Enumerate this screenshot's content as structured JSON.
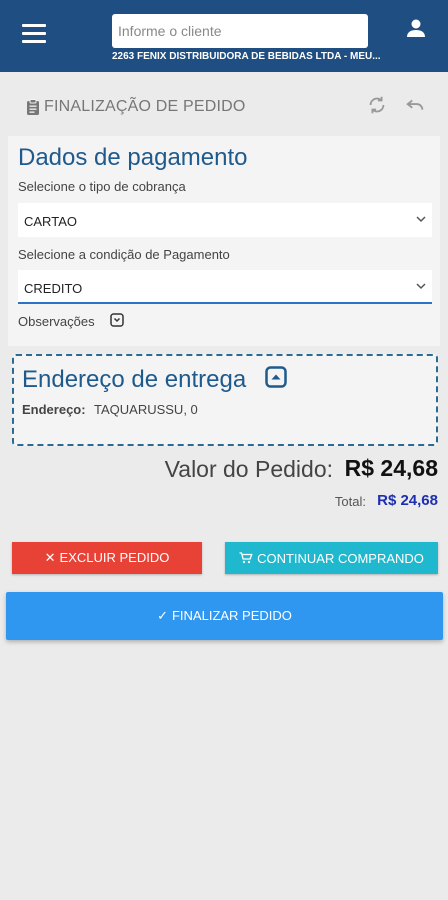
{
  "topbar": {
    "client_placeholder": "Informe o cliente",
    "client_name": "2263 FENIX DISTRIBUIDORA DE BEBIDAS LTDA - MEU..."
  },
  "header": {
    "title": "FINALIZAÇÃO DE PEDIDO"
  },
  "payment": {
    "title": "Dados de pagamento",
    "billing_label": "Selecione o tipo de cobrança",
    "billing_value": "CARTAO",
    "condition_label": "Selecione a condição de Pagamento",
    "condition_value": "CREDITO",
    "observations_label": "Observações"
  },
  "address": {
    "title": "Endereço de entrega",
    "label": "Endereço:",
    "value": "TAQUARUSSU, 0"
  },
  "summary": {
    "order_value_label": "Valor do Pedido:",
    "order_value": "R$ 24,68",
    "total_label": "Total:",
    "total_value": "R$ 24,68"
  },
  "actions": {
    "delete_label": "EXCLUIR PEDIDO",
    "continue_label": "CONTINUAR COMPRANDO",
    "finalize_label": "FINALIZAR PEDIDO"
  },
  "colors": {
    "topbar": "#1f4e82",
    "delete": "#e84136",
    "continue": "#1fb8cf",
    "finalize": "#2f97f0",
    "title_blue": "#1f5a8c",
    "total_blue": "#1d2fb0"
  },
  "icons": [
    "menu-icon",
    "user-icon",
    "clipboard-icon",
    "refresh-icon",
    "undo-icon",
    "chevron-down-icon",
    "expand-icon",
    "collapse-icon",
    "close-icon",
    "cart-icon",
    "check-icon"
  ]
}
